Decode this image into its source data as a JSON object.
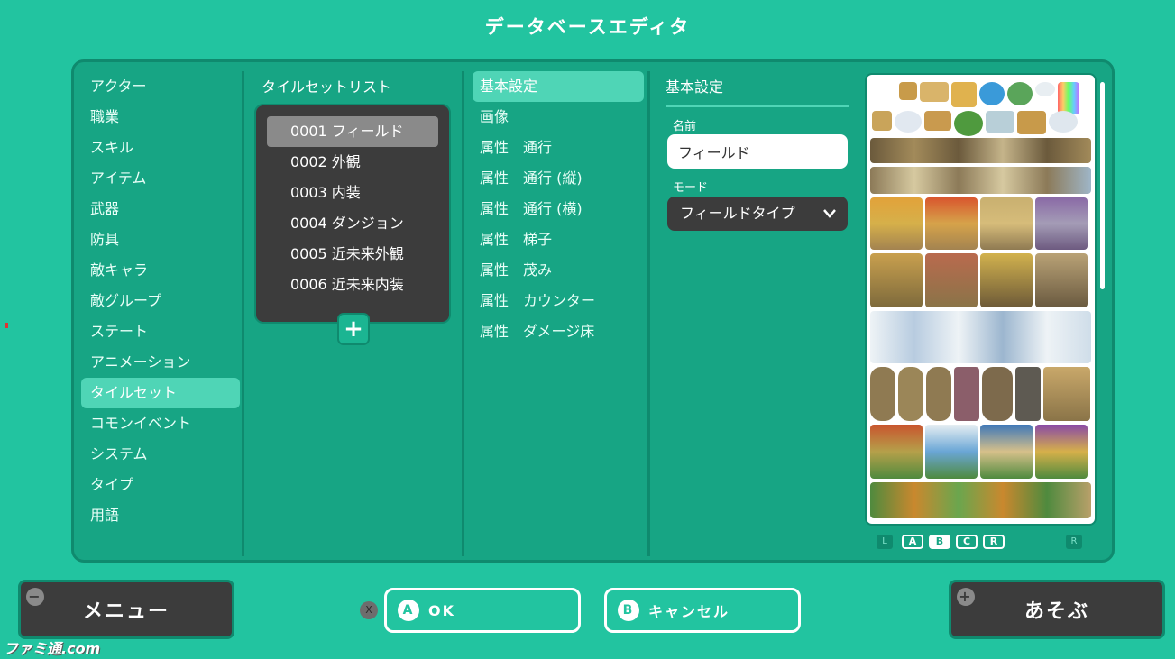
{
  "window": {
    "title": "データベースエディタ"
  },
  "categories": [
    {
      "label": "アクター"
    },
    {
      "label": "職業"
    },
    {
      "label": "スキル"
    },
    {
      "label": "アイテム"
    },
    {
      "label": "武器"
    },
    {
      "label": "防具"
    },
    {
      "label": "敵キャラ"
    },
    {
      "label": "敵グループ"
    },
    {
      "label": "ステート"
    },
    {
      "label": "アニメーション"
    },
    {
      "label": "タイルセット",
      "selected": true
    },
    {
      "label": "コモンイベント"
    },
    {
      "label": "システム"
    },
    {
      "label": "タイプ"
    },
    {
      "label": "用語"
    }
  ],
  "tileset_list": {
    "header": "タイルセットリスト",
    "items": [
      {
        "label": "0001 フィールド",
        "selected": true
      },
      {
        "label": "0002 外観"
      },
      {
        "label": "0003 内装"
      },
      {
        "label": "0004 ダンジョン"
      },
      {
        "label": "0005 近未来外観"
      },
      {
        "label": "0006 近未来内装"
      }
    ],
    "add_label": "+"
  },
  "properties": [
    {
      "label": "基本設定",
      "selected": true
    },
    {
      "label": "画像"
    },
    {
      "label": "属性　通行"
    },
    {
      "label": "属性　通行 (縦)"
    },
    {
      "label": "属性　通行 (横)"
    },
    {
      "label": "属性　梯子"
    },
    {
      "label": "属性　茂み"
    },
    {
      "label": "属性　カウンター"
    },
    {
      "label": "属性　ダメージ床"
    }
  ],
  "detail": {
    "header": "基本設定",
    "name_label": "名前",
    "name_value": "フィールド",
    "mode_label": "モード",
    "mode_value": "フィールドタイプ",
    "chevron": "chevron-down-icon"
  },
  "preview_tabs": {
    "left_shoulder": "L",
    "right_shoulder": "R",
    "tabs": [
      {
        "label": "A"
      },
      {
        "label": "B",
        "selected": true
      },
      {
        "label": "C"
      },
      {
        "label": "R"
      }
    ]
  },
  "bottom_bar": {
    "menu_label": "メニュー",
    "menu_badge": "−",
    "x_key": "X",
    "ok_key": "A",
    "ok_label": "OK",
    "cancel_key": "B",
    "cancel_label": "キャンセル",
    "play_label": "あそぶ",
    "play_badge": "+"
  },
  "watermark": "ファミ通.com",
  "colors": {
    "background": "#22c4a0",
    "panel": "#17a584",
    "selected": "#4fd5b6",
    "dark_box": "#3c3c3c"
  }
}
